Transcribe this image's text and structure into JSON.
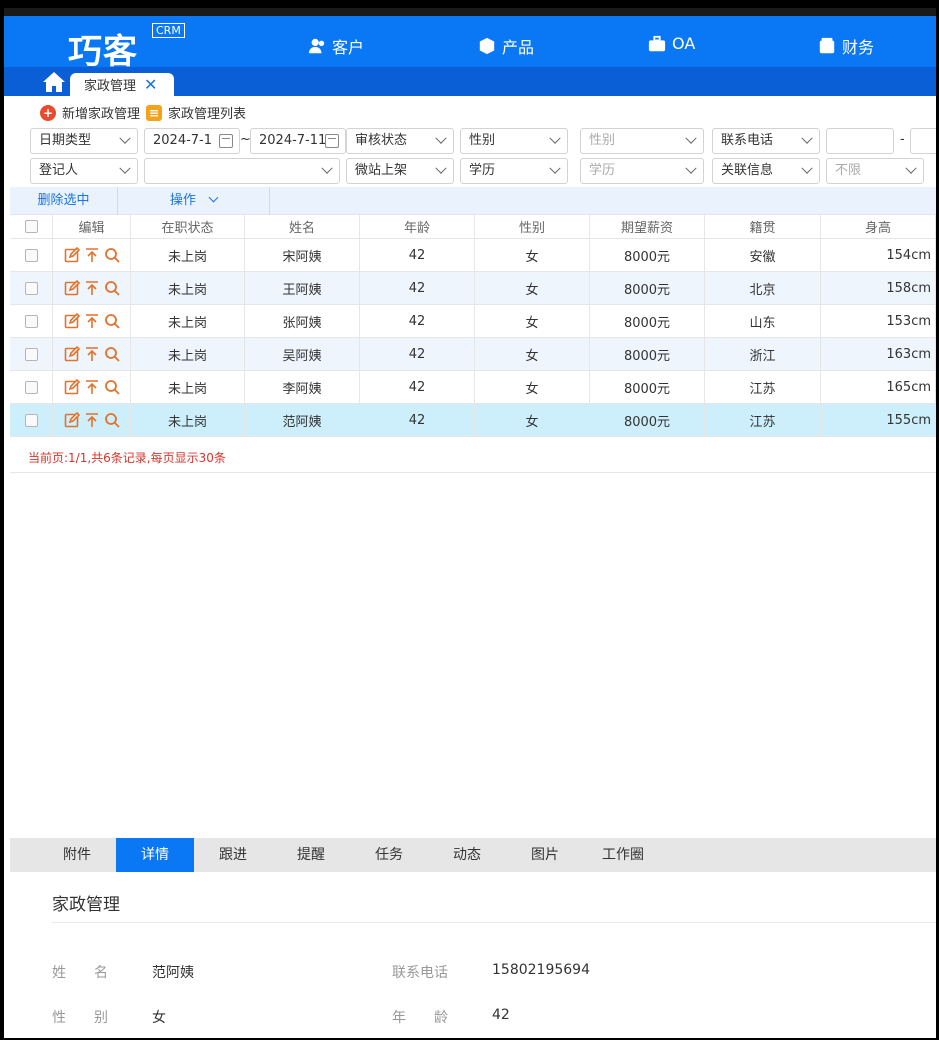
{
  "app": {
    "logo": "巧客",
    "logo_tag": "CRM"
  },
  "nav": [
    {
      "label": "客户",
      "icon": "user-icon"
    },
    {
      "label": "产品",
      "icon": "box-icon"
    },
    {
      "label": "OA",
      "icon": "briefcase-icon"
    },
    {
      "label": "财务",
      "icon": "wallet-icon"
    }
  ],
  "tabs": {
    "active_tab": "家政管理",
    "home_icon": "home-icon",
    "close_icon": "close-icon"
  },
  "actions": {
    "add_label": "新增家政管理",
    "list_label": "家政管理列表"
  },
  "filters": {
    "date_type": "日期类型",
    "date_from": "2024-7-1",
    "date_sep": "~",
    "date_to": "2024-7-11",
    "audit_status": "审核状态",
    "gender": "性别",
    "gender2_placeholder": "性别",
    "phone": "联系电话",
    "range_sep": "-",
    "registrant": "登记人",
    "registrant_value": "",
    "wechat_listing": "微站上架",
    "education": "学历",
    "education2_placeholder": "学历",
    "related_info": "关联信息",
    "unlimited_placeholder": "不限"
  },
  "toolbar": {
    "delete_selected": "删除选中",
    "operations": "操作"
  },
  "table": {
    "columns": [
      "编辑",
      "在职状态",
      "姓名",
      "年龄",
      "性别",
      "期望薪资",
      "籍贯",
      "身高"
    ],
    "rows": [
      {
        "status": "未上岗",
        "name": "宋阿姨",
        "age": "42",
        "gender": "女",
        "salary": "8000元",
        "origin": "安徽",
        "height": "154cm"
      },
      {
        "status": "未上岗",
        "name": "王阿姨",
        "age": "42",
        "gender": "女",
        "salary": "8000元",
        "origin": "北京",
        "height": "158cm"
      },
      {
        "status": "未上岗",
        "name": "张阿姨",
        "age": "42",
        "gender": "女",
        "salary": "8000元",
        "origin": "山东",
        "height": "153cm"
      },
      {
        "status": "未上岗",
        "name": "吴阿姨",
        "age": "42",
        "gender": "女",
        "salary": "8000元",
        "origin": "浙江",
        "height": "163cm"
      },
      {
        "status": "未上岗",
        "name": "李阿姨",
        "age": "42",
        "gender": "女",
        "salary": "8000元",
        "origin": "江苏",
        "height": "165cm"
      },
      {
        "status": "未上岗",
        "name": "范阿姨",
        "age": "42",
        "gender": "女",
        "salary": "8000元",
        "origin": "江苏",
        "height": "155cm"
      }
    ],
    "selected_row": 5,
    "row_icons": [
      "edit-icon",
      "pin-top-icon",
      "search-icon"
    ]
  },
  "pager": {
    "text": "当前页:1/1,共6条记录,每页显示30条"
  },
  "detail_tabs": [
    "附件",
    "详情",
    "跟进",
    "提醒",
    "任务",
    "动态",
    "图片",
    "工作圈"
  ],
  "detail_active_tab": "详情",
  "detail": {
    "title": "家政管理",
    "fields": [
      {
        "label": "姓　　名",
        "value": "范阿姨"
      },
      {
        "label": "联系电话",
        "value": "15802195694"
      },
      {
        "label": "性　　别",
        "value": "女"
      },
      {
        "label": "年　　龄",
        "value": "42"
      }
    ]
  },
  "colors": {
    "brand": "#0a78f4",
    "tab_bar": "#0a5fd6",
    "accent_orange": "#e2722c",
    "pager_red": "#d9342b",
    "row_alt": "#eef5fd",
    "row_selected": "#cdeffb"
  }
}
